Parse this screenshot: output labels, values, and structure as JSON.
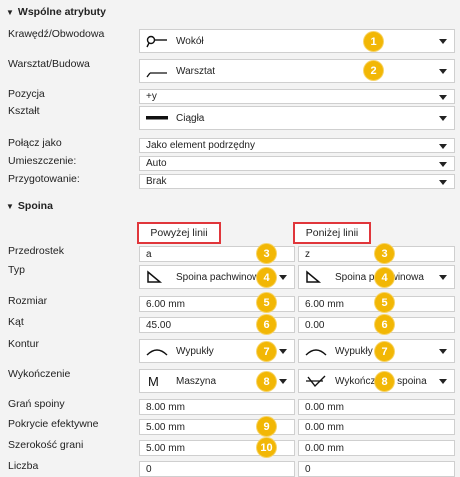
{
  "common": {
    "title": "Wspólne atrybuty",
    "rows": {
      "krawedz": {
        "label": "Krawędź/Obwodowa",
        "value": "Wokół",
        "icon": "weld-around-icon"
      },
      "warsztat": {
        "label": "Warsztat/Budowa",
        "value": "Warsztat",
        "icon": "shop-weld-icon"
      },
      "pozycja": {
        "label": "Pozycja",
        "value": "+y"
      },
      "ksztalt": {
        "label": "Kształt",
        "value": "Ciągła",
        "icon": "continuous-line-icon"
      },
      "polacz": {
        "label": "Połącz jako",
        "value": "Jako element podrzędny"
      },
      "umieszczenie": {
        "label": "Umieszczenie:",
        "value": "Auto"
      },
      "przygotowanie": {
        "label": "Przygotowanie:",
        "value": "Brak"
      }
    }
  },
  "weld": {
    "title": "Spoina",
    "above_header": "Powyżej linii",
    "below_header": "Poniżej linii",
    "rows": {
      "przedrostek": {
        "label": "Przedrostek",
        "above": "a",
        "below": "z"
      },
      "typ": {
        "label": "Typ",
        "above": "Spoina pachwinowa",
        "below": "Spoina pachwinowa",
        "icon": "fillet-weld-icon"
      },
      "rozmiar": {
        "label": "Rozmiar",
        "above": "6.00 mm",
        "below": "6.00 mm"
      },
      "kat": {
        "label": "Kąt",
        "above": "45.00",
        "below": "0.00"
      },
      "kontur": {
        "label": "Kontur",
        "above": "Wypukły",
        "below": "Wypukły",
        "icon": "convex-contour-icon"
      },
      "wykonczenie": {
        "label": "Wykończenie",
        "above": "Maszyna",
        "below": "Wykończenie spoina",
        "icon_above": "machine-finish-icon",
        "icon_below": "weld-finish-icon"
      },
      "gran": {
        "label": "Grań spoiny",
        "above": "8.00 mm",
        "below": "0.00 mm"
      },
      "pokrycie": {
        "label": "Pokrycie efektywne",
        "above": "5.00 mm",
        "below": "0.00 mm"
      },
      "szerokosc": {
        "label": "Szerokość grani",
        "above": "5.00 mm",
        "below": "0.00 mm"
      },
      "liczba": {
        "label": "Liczba",
        "above": "0",
        "below": "0"
      }
    }
  },
  "badges": [
    "1",
    "2",
    "3",
    "3",
    "4",
    "4",
    "5",
    "5",
    "6",
    "6",
    "7",
    "7",
    "8",
    "8",
    "9",
    "10"
  ],
  "colors": {
    "badge": "#f2b705",
    "highlight": "#e0363b"
  }
}
